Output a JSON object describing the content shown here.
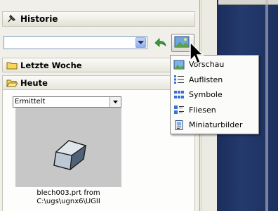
{
  "header": {
    "title": "Historie"
  },
  "toolbar": {
    "search_value": ""
  },
  "groups": {
    "last_week": "Letzte Woche",
    "today": "Heute"
  },
  "filter": {
    "selected": "Ermittelt"
  },
  "thumbnail": {
    "caption_line1": "blech003.prt from",
    "caption_line2": "C:\\ugs\\ugnx6\\UGII"
  },
  "menu": {
    "items": [
      {
        "label": "Vorschau",
        "icon": "preview-icon"
      },
      {
        "label": "Auflisten",
        "icon": "list-icon"
      },
      {
        "label": "Symbole",
        "icon": "icons-view-icon"
      },
      {
        "label": "Fliesen",
        "icon": "tiles-icon"
      },
      {
        "label": "Miniaturbilder",
        "icon": "thumbnails-icon"
      }
    ]
  },
  "colors": {
    "viewport": "#1d315f",
    "accent": "#3a6fd8",
    "folder": "#f5d75a"
  }
}
